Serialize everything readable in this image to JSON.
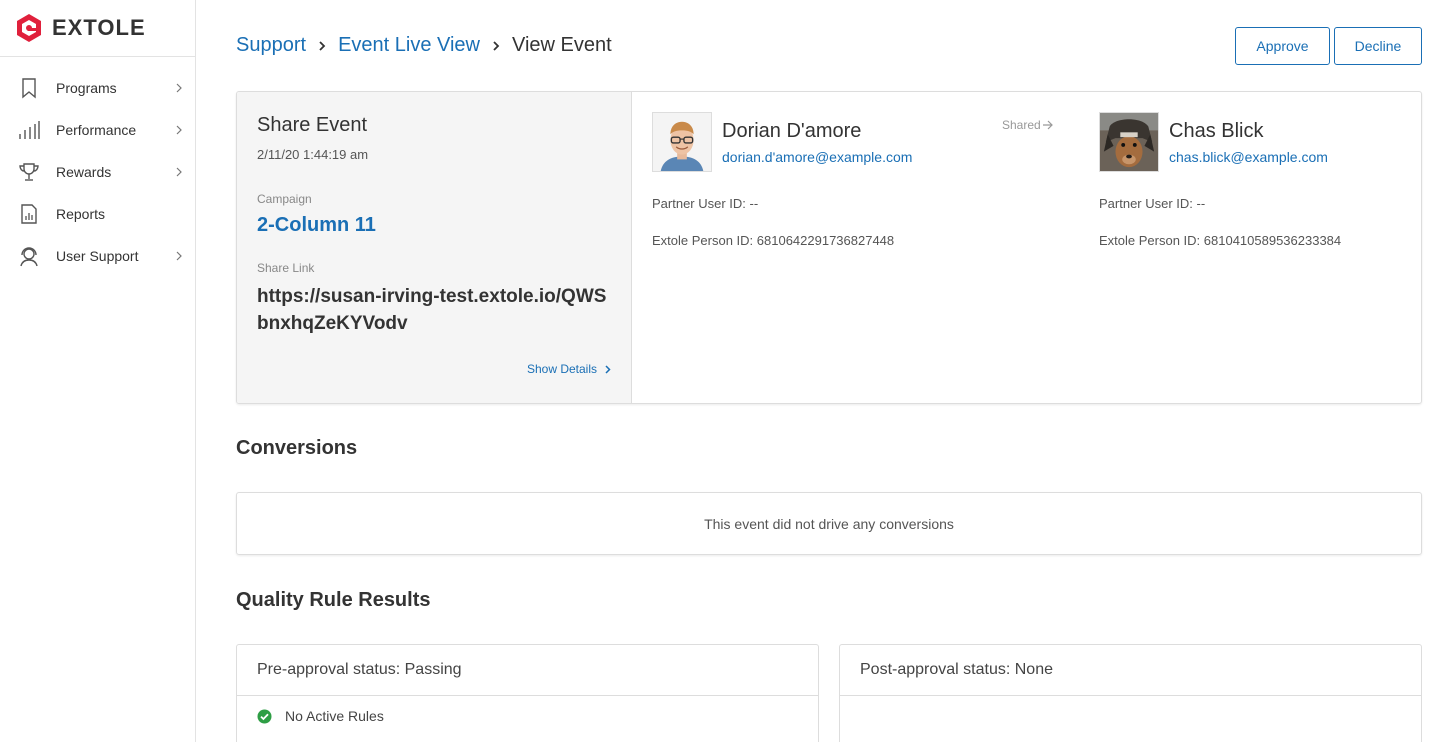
{
  "brand": {
    "name": "EXTOLE",
    "accent": "#e0203c"
  },
  "sidebar": {
    "items": [
      {
        "label": "Programs",
        "icon": "bookmark-icon",
        "has_chevron": true
      },
      {
        "label": "Performance",
        "icon": "bar-chart-icon",
        "has_chevron": true
      },
      {
        "label": "Rewards",
        "icon": "trophy-icon",
        "has_chevron": true
      },
      {
        "label": "Reports",
        "icon": "report-icon",
        "has_chevron": false
      },
      {
        "label": "User Support",
        "icon": "support-icon",
        "has_chevron": true
      }
    ]
  },
  "breadcrumb": {
    "items": [
      "Support",
      "Event Live View"
    ],
    "current": "View Event"
  },
  "actions": {
    "approve": "Approve",
    "decline": "Decline"
  },
  "event": {
    "title": "Share Event",
    "date": "2/11/20 1:44:19 am",
    "campaign_label": "Campaign",
    "campaign": "2-Column 11",
    "share_link_label": "Share Link",
    "share_link": "https://susan-irving-test.extole.io/QWSbnxhqZeKYVodv",
    "show_details": "Show Details"
  },
  "sharer": {
    "name": "Dorian D'amore",
    "email": "dorian.d'amore@example.com",
    "partner_id": "Partner User ID: --",
    "person_id": "Extole Person ID: 6810642291736827448"
  },
  "shared_label": "Shared",
  "recipient": {
    "name": "Chas Blick",
    "email": "chas.blick@example.com",
    "partner_id": "Partner User ID: --",
    "person_id": "Extole Person ID: 6810410589536233384"
  },
  "conversions": {
    "title": "Conversions",
    "empty": "This event did not drive any conversions"
  },
  "quality": {
    "title": "Quality Rule Results",
    "pre": {
      "status": "Pre-approval status: Passing",
      "rule": "No Active Rules"
    },
    "post": {
      "status": "Post-approval status: None"
    }
  },
  "colors": {
    "link": "#1a6fb5",
    "success": "#2e9e45"
  }
}
